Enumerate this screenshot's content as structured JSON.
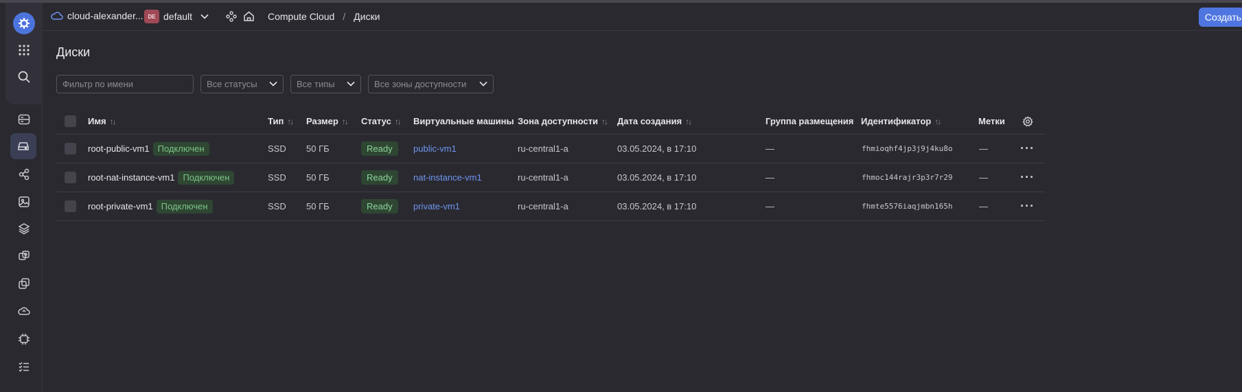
{
  "header": {
    "cloud_name": "cloud-alexander...",
    "folder_badge": "DE",
    "folder_name": "default",
    "breadcrumb_service": "Compute Cloud",
    "breadcrumb_sep": "/",
    "breadcrumb_current": "Диски",
    "create_button": "Создать диск"
  },
  "page": {
    "title": "Диски"
  },
  "filters": {
    "name_placeholder": "Фильтр по имени",
    "status": "Все статусы",
    "type": "Все типы",
    "zone": "Все зоны доступности"
  },
  "table": {
    "columns": {
      "name": "Имя",
      "type": "Тип",
      "size": "Размер",
      "status": "Статус",
      "vms": "Виртуальные машины",
      "zone": "Зона доступности",
      "created": "Дата создания",
      "placement": "Группа размещения",
      "id": "Идентификатор",
      "labels": "Метки"
    },
    "rows": [
      {
        "name": "root-public-vm1",
        "badge": "Подключен",
        "type": "SSD",
        "size": "50 ГБ",
        "status": "Ready",
        "vm": "public-vm1",
        "zone": "ru-central1-a",
        "created": "03.05.2024, в 17:10",
        "placement": "—",
        "id": "fhmioqhf4jp3j9j4ku8o",
        "labels": "—"
      },
      {
        "name": "root-nat-instance-vm1",
        "badge": "Подключен",
        "type": "SSD",
        "size": "50 ГБ",
        "status": "Ready",
        "vm": "nat-instance-vm1",
        "zone": "ru-central1-a",
        "created": "03.05.2024, в 17:10",
        "placement": "—",
        "id": "fhmoc144rajr3p3r7r29",
        "labels": "—"
      },
      {
        "name": "root-private-vm1",
        "badge": "Подключен",
        "type": "SSD",
        "size": "50 ГБ",
        "status": "Ready",
        "vm": "private-vm1",
        "zone": "ru-central1-a",
        "created": "03.05.2024, в 17:10",
        "placement": "—",
        "id": "fhmte5576iaqjmbn165h",
        "labels": "—"
      }
    ]
  },
  "icons": {
    "logo": "compute-cloud-logo-icon",
    "row_actions": "more-horizontal-icon",
    "settings": "gear-icon"
  },
  "colors": {
    "accent": "#4f76e0",
    "status_ready_bg": "#2e4632",
    "status_ready_fg": "#8fd49b",
    "link": "#6e96ef"
  }
}
